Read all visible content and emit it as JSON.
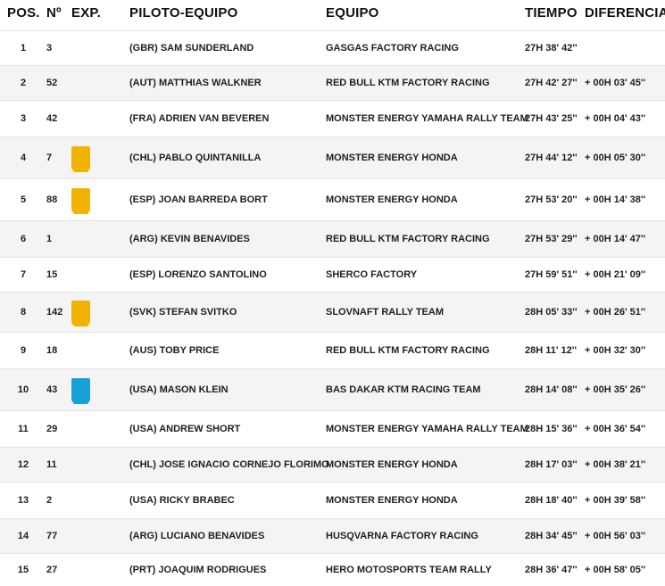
{
  "headers": {
    "pos": "POS.",
    "num": "Nº",
    "exp": "EXP.",
    "piloto": "PILOTO-EQUIPO",
    "equipo": "EQUIPO",
    "tiempo": "TIEMPO",
    "diferencia": "DIFERENCIA"
  },
  "colors": {
    "exp_yellow": "#f0b400",
    "exp_blue": "#1aa0d8"
  },
  "rows": [
    {
      "pos": "1",
      "num": "3",
      "exp": "",
      "piloto": "(GBR)   SAM SUNDERLAND",
      "equipo": "GASGAS FACTORY RACING",
      "tiempo": "27H 38' 42''",
      "diferencia": ""
    },
    {
      "pos": "2",
      "num": "52",
      "exp": "",
      "piloto": "(AUT)   MATTHIAS WALKNER",
      "equipo": "RED BULL KTM FACTORY RACING",
      "tiempo": "27H 42' 27''",
      "diferencia": "+ 00H 03' 45''"
    },
    {
      "pos": "3",
      "num": "42",
      "exp": "",
      "piloto": "(FRA)   ADRIEN VAN BEVEREN",
      "equipo": "MONSTER ENERGY YAMAHA RALLY TEAM",
      "tiempo": "27H 43' 25''",
      "diferencia": "+ 00H 04' 43''"
    },
    {
      "pos": "4",
      "num": "7",
      "exp": "yellow",
      "piloto": "(CHL)   PABLO QUINTANILLA",
      "equipo": "MONSTER ENERGY HONDA",
      "tiempo": "27H 44' 12''",
      "diferencia": "+ 00H 05' 30''"
    },
    {
      "pos": "5",
      "num": "88",
      "exp": "yellow",
      "piloto": "(ESP)   JOAN BARREDA BORT",
      "equipo": "MONSTER ENERGY HONDA",
      "tiempo": "27H 53' 20''",
      "diferencia": "+ 00H 14' 38''"
    },
    {
      "pos": "6",
      "num": "1",
      "exp": "",
      "piloto": "(ARG)   KEVIN BENAVIDES",
      "equipo": "RED BULL KTM FACTORY RACING",
      "tiempo": "27H 53' 29''",
      "diferencia": "+ 00H 14' 47''"
    },
    {
      "pos": "7",
      "num": "15",
      "exp": "",
      "piloto": "(ESP)   LORENZO SANTOLINO",
      "equipo": "SHERCO FACTORY",
      "tiempo": "27H 59' 51''",
      "diferencia": "+ 00H 21' 09''"
    },
    {
      "pos": "8",
      "num": "142",
      "exp": "yellow",
      "piloto": "(SVK)   STEFAN SVITKO",
      "equipo": "SLOVNAFT RALLY TEAM",
      "tiempo": "28H 05' 33''",
      "diferencia": "+ 00H 26' 51''"
    },
    {
      "pos": "9",
      "num": "18",
      "exp": "",
      "piloto": "(AUS)   TOBY PRICE",
      "equipo": "RED BULL KTM FACTORY RACING",
      "tiempo": "28H 11' 12''",
      "diferencia": "+ 00H 32' 30''"
    },
    {
      "pos": "10",
      "num": "43",
      "exp": "blue",
      "piloto": "(USA)   MASON KLEIN",
      "equipo": "BAS DAKAR KTM RACING TEAM",
      "tiempo": "28H 14' 08''",
      "diferencia": "+ 00H 35' 26''"
    },
    {
      "pos": "11",
      "num": "29",
      "exp": "",
      "piloto": "(USA)   ANDREW SHORT",
      "equipo": "MONSTER ENERGY YAMAHA RALLY TEAM",
      "tiempo": "28H 15' 36''",
      "diferencia": "+ 00H 36' 54''"
    },
    {
      "pos": "12",
      "num": "11",
      "exp": "",
      "piloto": "(CHL)   JOSE IGNACIO CORNEJO FLORIMO",
      "equipo": "MONSTER ENERGY HONDA",
      "tiempo": "28H 17' 03''",
      "diferencia": "+ 00H 38' 21''"
    },
    {
      "pos": "13",
      "num": "2",
      "exp": "",
      "piloto": "(USA)   RICKY BRABEC",
      "equipo": "MONSTER ENERGY HONDA",
      "tiempo": "28H 18' 40''",
      "diferencia": "+ 00H 39' 58''"
    },
    {
      "pos": "14",
      "num": "77",
      "exp": "",
      "piloto": "(ARG)   LUCIANO BENAVIDES",
      "equipo": "HUSQVARNA FACTORY RACING",
      "tiempo": "28H 34' 45''",
      "diferencia": "+ 00H 56' 03''"
    },
    {
      "pos": "15",
      "num": "27",
      "exp": "",
      "piloto": "(PRT)   JOAQUIM RODRIGUES",
      "equipo": "HERO MOTOSPORTS TEAM RALLY",
      "tiempo": "28H 36' 47''",
      "diferencia": "+ 00H 58' 05''"
    }
  ]
}
